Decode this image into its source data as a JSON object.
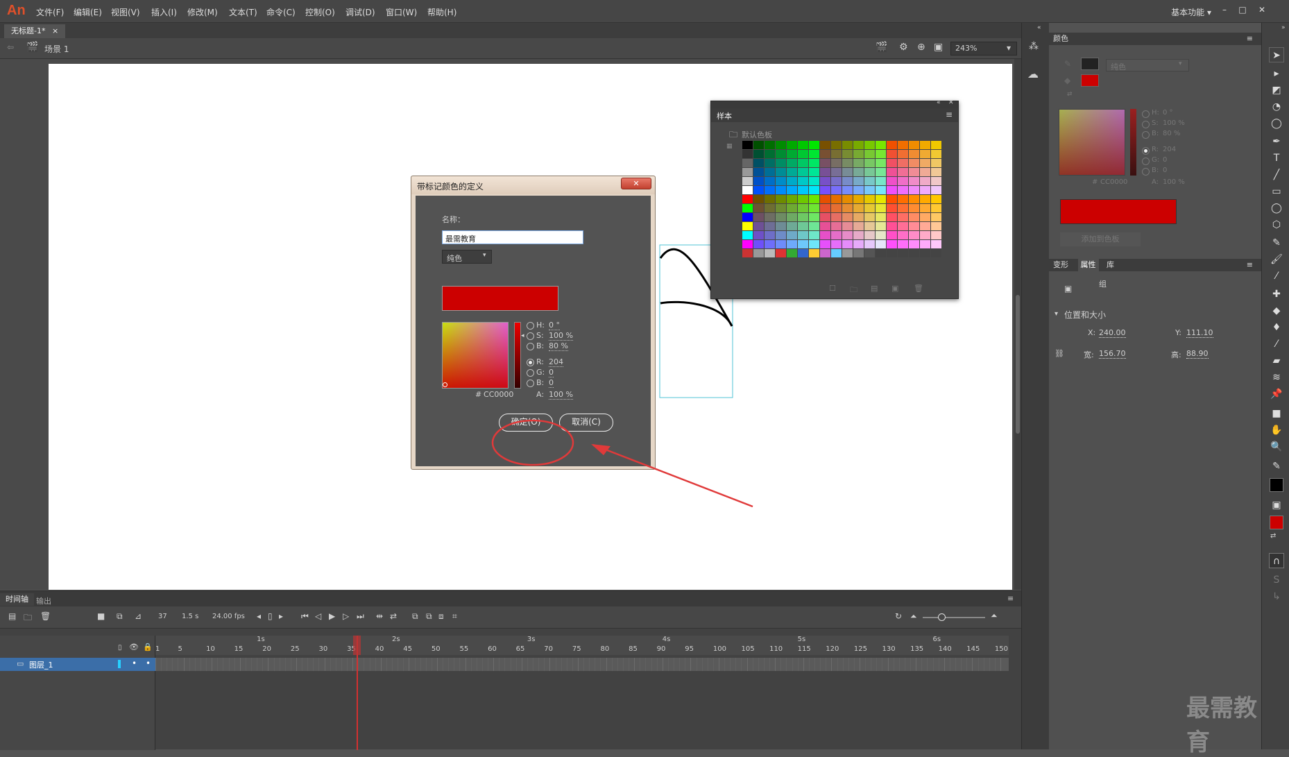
{
  "app": {
    "logo": "An"
  },
  "menu": [
    "文件(F)",
    "编辑(E)",
    "视图(V)",
    "插入(I)",
    "修改(M)",
    "文本(T)",
    "命令(C)",
    "控制(O)",
    "调试(D)",
    "窗口(W)",
    "帮助(H)"
  ],
  "workspace": "基本功能",
  "window_controls": {
    "minimize": "–",
    "maximize": "□",
    "close": "✕"
  },
  "document": {
    "tab": "无标题-1*",
    "tab_close": "×",
    "scene": "场景 1",
    "zoom": "243%"
  },
  "dialog": {
    "title": "带标记颜色的定义",
    "name_label": "名称：",
    "name_value": "最需教育",
    "fill_type": "纯色",
    "h_label": "H:",
    "h_value": "0 °",
    "s_label": "S:",
    "s_value": "100 %",
    "b_label": "B:",
    "b_value": "80 %",
    "r_label": "R:",
    "r_value": "204",
    "g_label": "G:",
    "g_value": "0",
    "bb_label": "B:",
    "bb_value": "0",
    "hex_label": "#",
    "hex_value": "CC0000",
    "a_label": "A:",
    "a_value": "100 %",
    "ok": "确定(O)",
    "cancel": "取消(C)",
    "close": "✕",
    "color": "#cc0000"
  },
  "swatches": {
    "title": "样本",
    "folder": "默认色板"
  },
  "color_panel": {
    "title": "颜色",
    "fill_type": "纯色",
    "h_label": "H:",
    "h_value": "0 °",
    "s_label": "S:",
    "s_value": "100 %",
    "b_label": "B:",
    "b_value": "80 %",
    "r_label": "R:",
    "r_value": "204",
    "g_label": "G:",
    "g_value": "0",
    "bb_label": "B:",
    "bb_value": "0",
    "hex_label": "#",
    "hex_value": "CC0000",
    "a_label": "A:",
    "a_value": "100 %",
    "add_swatch": "添加到色板"
  },
  "properties": {
    "tabs": [
      "变形",
      "属性",
      "库"
    ],
    "object_type": "组",
    "section": "位置和大小",
    "x_label": "X:",
    "x_value": "240.00",
    "y_label": "Y:",
    "y_value": "111.10",
    "w_label": "宽:",
    "w_value": "156.70",
    "h_label": "高:",
    "h_value": "88.90"
  },
  "timeline": {
    "tabs": [
      "时间轴",
      "输出"
    ],
    "frame": "37",
    "time": "1.5 s",
    "fps": "24.00 fps",
    "layer": "图层_1",
    "seconds": [
      "1s",
      "2s",
      "3s",
      "4s",
      "5s",
      "6s"
    ],
    "frame_numbers": [
      "1",
      "5",
      "10",
      "15",
      "20",
      "25",
      "30",
      "35",
      "40",
      "45",
      "50",
      "55",
      "60",
      "65",
      "70",
      "75",
      "80",
      "85",
      "90",
      "95",
      "100",
      "105",
      "110",
      "115",
      "120",
      "125",
      "130",
      "135",
      "140",
      "145",
      "150"
    ]
  },
  "watermark": "最需教育",
  "colors": {
    "accent": "#cc0000",
    "selection": "#3b6ea8",
    "panel": "#535353"
  }
}
